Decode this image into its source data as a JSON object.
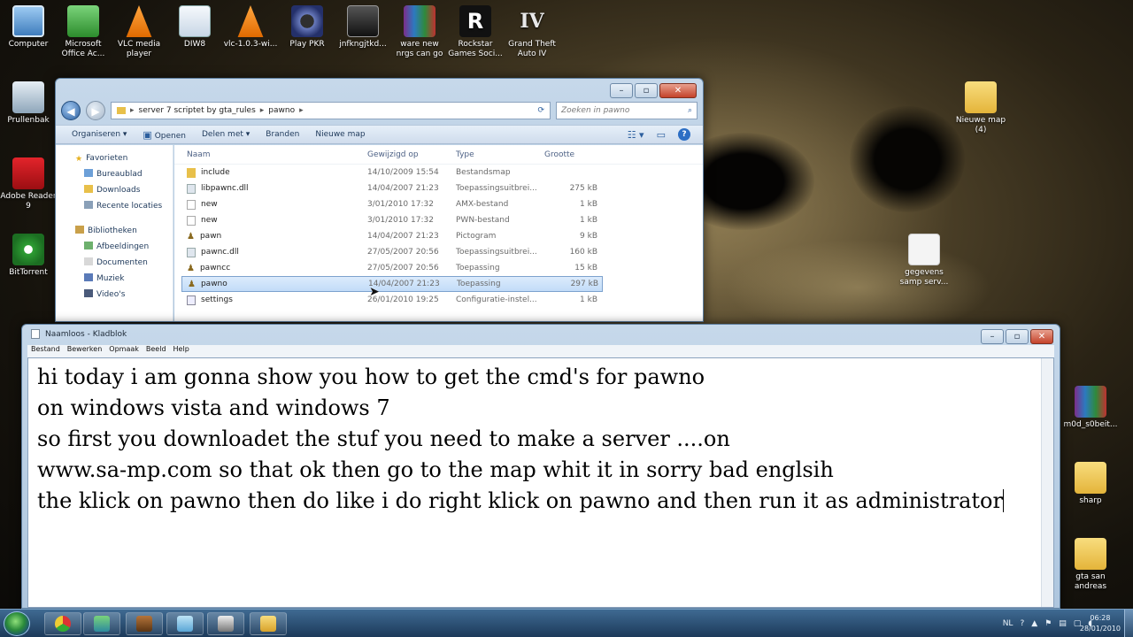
{
  "desktop": {
    "top_icons": [
      {
        "label": "Computer",
        "icon": "computer-icon"
      },
      {
        "label": "Microsoft Office Ac...",
        "icon": "office-icon"
      },
      {
        "label": "VLC media player",
        "icon": "vlc-icon"
      },
      {
        "label": "DIW8",
        "icon": "document-icon"
      },
      {
        "label": "vlc-1.0.3-wi...",
        "icon": "vlc-icon"
      },
      {
        "label": "Play PKR",
        "icon": "pkr-icon"
      },
      {
        "label": "jnfkngjtkd...",
        "icon": "video-file-icon"
      },
      {
        "label": "ware new nrgs can go",
        "icon": "winrar-icon"
      },
      {
        "label": "Rockstar Games Soci...",
        "icon": "rockstar-icon"
      },
      {
        "label": "Grand Theft Auto IV",
        "icon": "gta-icon"
      }
    ],
    "left_icons": [
      {
        "label": "Prullenbak",
        "icon": "recycle-bin-icon"
      },
      {
        "label": "Adobe Reader 9",
        "icon": "adobe-icon"
      },
      {
        "label": "BitTorrent",
        "icon": "bittorrent-icon"
      }
    ],
    "right_icons": [
      {
        "label": "Nieuwe map (4)",
        "icon": "folder-icon"
      },
      {
        "label": "gegevens samp serv...",
        "icon": "file-icon"
      },
      {
        "label": "m0d_s0beit...",
        "icon": "winrar-icon"
      },
      {
        "label": "sharp",
        "icon": "folder-icon"
      },
      {
        "label": "gta san andreas",
        "icon": "folder-icon"
      }
    ]
  },
  "explorer": {
    "breadcrumb": [
      "server 7 scriptet by gta_rules",
      "pawno"
    ],
    "search_placeholder": "Zoeken in pawno",
    "toolbar": {
      "organize": "Organiseren",
      "open": "Openen",
      "share": "Delen met",
      "burn": "Branden",
      "new_folder": "Nieuwe map"
    },
    "nav": {
      "favorites": "Favorieten",
      "favorites_items": [
        "Bureaublad",
        "Downloads",
        "Recente locaties"
      ],
      "libraries": "Bibliotheken",
      "libraries_items": [
        "Afbeeldingen",
        "Documenten",
        "Muziek",
        "Video's"
      ]
    },
    "columns": {
      "name": "Naam",
      "date": "Gewijzigd op",
      "type": "Type",
      "size": "Grootte"
    },
    "files": [
      {
        "name": "include",
        "date": "14/10/2009 15:54",
        "type": "Bestandsmap",
        "size": "",
        "icon": "fi-folder"
      },
      {
        "name": "libpawnc.dll",
        "date": "14/04/2007 21:23",
        "type": "Toepassingsuitbrei...",
        "size": "275 kB",
        "icon": "fi-dll"
      },
      {
        "name": "new",
        "date": "3/01/2010 17:32",
        "type": "AMX-bestand",
        "size": "1 kB",
        "icon": "fi-file"
      },
      {
        "name": "new",
        "date": "3/01/2010 17:32",
        "type": "PWN-bestand",
        "size": "1 kB",
        "icon": "fi-file"
      },
      {
        "name": "pawn",
        "date": "14/04/2007 21:23",
        "type": "Pictogram",
        "size": "9 kB",
        "icon": "fi-paw"
      },
      {
        "name": "pawnc.dll",
        "date": "27/05/2007 20:56",
        "type": "Toepassingsuitbrei...",
        "size": "160 kB",
        "icon": "fi-dll"
      },
      {
        "name": "pawncc",
        "date": "27/05/2007 20:56",
        "type": "Toepassing",
        "size": "15 kB",
        "icon": "fi-paw"
      },
      {
        "name": "pawno",
        "date": "14/04/2007 21:23",
        "type": "Toepassing",
        "size": "297 kB",
        "icon": "fi-paw",
        "selected": true
      },
      {
        "name": "settings",
        "date": "26/01/2010 19:25",
        "type": "Configuratie-instel...",
        "size": "1 kB",
        "icon": "fi-cfg"
      }
    ]
  },
  "notepad": {
    "title": "Naamloos - Kladblok",
    "menu": [
      "Bestand",
      "Bewerken",
      "Opmaak",
      "Beeld",
      "Help"
    ],
    "lines": [
      "hi today i am gonna show you how to get the cmd's for pawno",
      "on windows vista and windows 7",
      "so first you downloadet the stuf you need to make a server ....on",
      "www.sa-mp.com so that ok then go to the map whit it in sorry bad englsih",
      "the klick on pawno then do like i do right klick on pawno and then run it as administrator"
    ]
  },
  "taskbar": {
    "lang": "NL",
    "time": "06:28",
    "date": "28/01/2010"
  }
}
